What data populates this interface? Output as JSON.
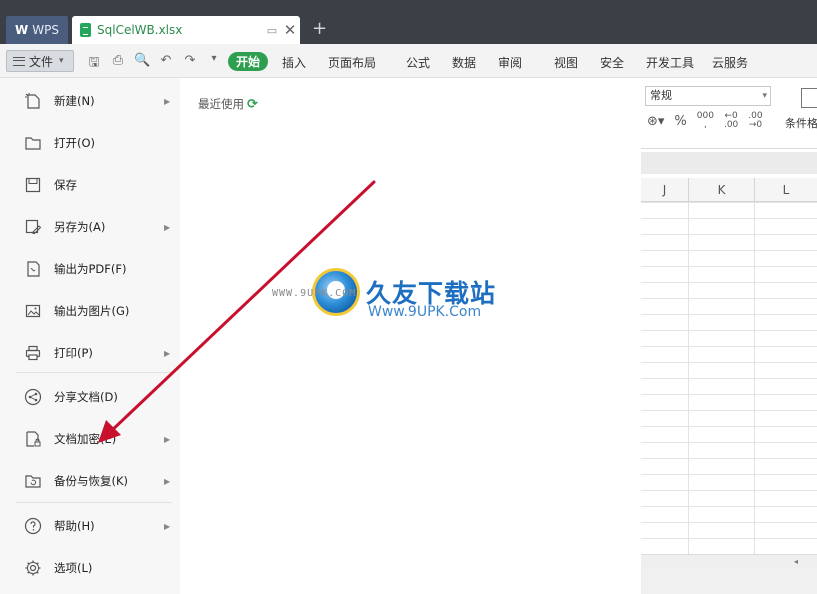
{
  "titlebar": {
    "wps_label": "WPS",
    "doc_tab": "SqlCelWB.xlsx",
    "new_tab": "+"
  },
  "ribbon": {
    "file_label": "文件",
    "start_label": "开始",
    "tabs": [
      "插入",
      "页面布局",
      "公式",
      "数据",
      "审阅",
      "视图",
      "安全",
      "开发工具",
      "云服务"
    ]
  },
  "file_menu": {
    "items": [
      {
        "label": "新建(N)",
        "icon": "new-file-icon",
        "submenu": true
      },
      {
        "label": "打开(O)",
        "icon": "folder-icon",
        "submenu": false
      },
      {
        "label": "保存",
        "icon": "save-icon",
        "submenu": false
      },
      {
        "label": "另存为(A)",
        "icon": "save-as-icon",
        "submenu": true
      },
      {
        "label": "输出为PDF(F)",
        "icon": "pdf-icon",
        "submenu": false
      },
      {
        "label": "输出为图片(G)",
        "icon": "image-icon",
        "submenu": false
      },
      {
        "label": "打印(P)",
        "icon": "printer-icon",
        "submenu": true
      },
      {
        "label": "分享文档(D)",
        "icon": "share-icon",
        "submenu": false
      },
      {
        "label": "文档加密(E)",
        "icon": "encrypt-icon",
        "submenu": true
      },
      {
        "label": "备份与恢复(K)",
        "icon": "backup-icon",
        "submenu": true
      },
      {
        "label": "帮助(H)",
        "icon": "help-icon",
        "submenu": true
      },
      {
        "label": "选项(L)",
        "icon": "gear-icon",
        "submenu": false
      }
    ],
    "recent_title": "最近使用"
  },
  "sheet": {
    "number_format": "常规",
    "conditional_format_label": "条件格",
    "columns": [
      "J",
      "K",
      "L"
    ]
  },
  "watermark": {
    "title": "久友下载站",
    "url": "Www.9UPK.Com",
    "small": "WWW.9UPK.COM"
  },
  "colors": {
    "accent_green": "#2e9e4f",
    "annotation_arrow": "#c8102e",
    "titlebar_bg": "#3b3f46"
  }
}
